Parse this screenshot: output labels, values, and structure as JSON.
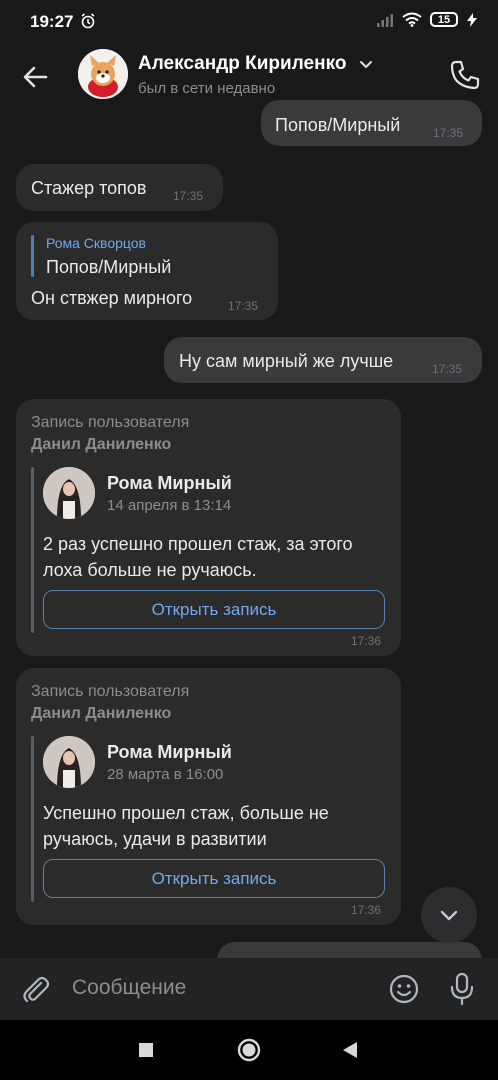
{
  "status_bar": {
    "time": "19:27",
    "battery": "15"
  },
  "header": {
    "contact_name": "Александр Кириленко",
    "contact_status": "был в сети недавно"
  },
  "messages": [
    {
      "text": "Попов/Мирный",
      "time": "17:35"
    },
    {
      "text": "Стажер топов",
      "time": "17:35"
    },
    {
      "reply_author": "Рома Скворцов",
      "reply_text": "Попов/Мирный",
      "text": "Он ствжер мирного",
      "time": "17:35"
    },
    {
      "text": "Ну сам мирный же лучше",
      "time": "17:35"
    }
  ],
  "posts": [
    {
      "header": "Запись пользователя",
      "author": "Данил Даниленко",
      "name": "Рома Мирный",
      "date": "14 апреля в 13:14",
      "text_line1": "2 раз успешно прошел стаж, за этого",
      "text_line2": "лоха больше не ручаюсь.",
      "button": "Открыть запись",
      "time": "17:36"
    },
    {
      "header": "Запись пользователя",
      "author": "Данил Даниленко",
      "name": "Рома Мирный",
      "date": "28 марта в 16:00",
      "text_line1": "Успешно прошел стаж, больше не",
      "text_line2": "ручаюсь, удачи в развитии",
      "button": "Открыть запись",
      "time": "17:36"
    }
  ],
  "composer": {
    "placeholder": "Сообщение"
  }
}
